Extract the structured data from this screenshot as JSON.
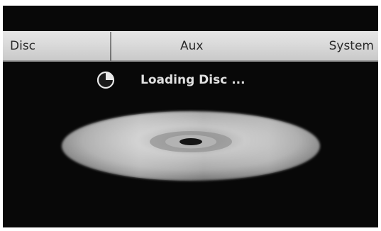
{
  "menu": {
    "items": [
      {
        "label": "Disc"
      },
      {
        "label": "Aux"
      },
      {
        "label": "System"
      }
    ]
  },
  "status": {
    "text": "Loading Disc ...",
    "icon": "loading-spinner-icon"
  },
  "graphic": {
    "icon": "disc-icon"
  },
  "colors": {
    "screen_background": "#080808",
    "menu_bar": "#d7d7d7",
    "menu_text": "#2a2a2a",
    "status_text": "#e0e0e0"
  }
}
